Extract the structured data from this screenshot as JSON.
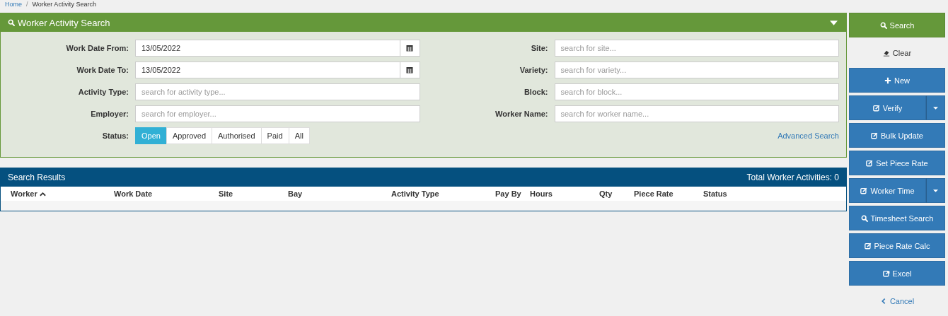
{
  "breadcrumb_separator": "/",
  "breadcrumb": [
    {
      "label": "Home",
      "kind": "link"
    },
    {
      "label": "Worker Activity Search",
      "kind": "current"
    }
  ],
  "search_panel": {
    "title": "Worker Activity Search",
    "expanded": true,
    "left_fields": [
      {
        "label": "Work Date From:",
        "value": "13/05/2022",
        "kind": "date"
      },
      {
        "label": "Work Date To:",
        "value": "13/05/2022",
        "kind": "date"
      },
      {
        "label": "Activity Type:",
        "placeholder": "search for activity type...",
        "kind": "text"
      },
      {
        "label": "Employer:",
        "placeholder": "search for employer...",
        "kind": "text"
      }
    ],
    "right_fields": [
      {
        "label": "Site:",
        "placeholder": "search for site...",
        "kind": "text"
      },
      {
        "label": "Variety:",
        "placeholder": "search for variety...",
        "kind": "text"
      },
      {
        "label": "Block:",
        "placeholder": "search for block...",
        "kind": "text"
      },
      {
        "label": "Worker Name:",
        "placeholder": "search for worker name...",
        "kind": "text"
      }
    ],
    "status_label": "Status:",
    "status_options": [
      {
        "label": "Open",
        "selected": true
      },
      {
        "label": "Approved",
        "selected": false
      },
      {
        "label": "Authorised",
        "selected": false
      },
      {
        "label": "Paid",
        "selected": false
      },
      {
        "label": "All",
        "selected": false
      }
    ],
    "advanced_link": "Advanced Search"
  },
  "results": {
    "title": "Search Results",
    "total": "Total Worker Activities: 0",
    "columns": [
      {
        "label": "Worker",
        "sorted": true
      },
      {
        "label": "Work Date",
        "sorted": false
      },
      {
        "label": "Site",
        "sorted": false
      },
      {
        "label": "Bay",
        "sorted": false
      },
      {
        "label": "Activity Type",
        "sorted": false
      },
      {
        "label": "Pay By",
        "sorted": false
      },
      {
        "label": "Hours",
        "sorted": false
      },
      {
        "label": "Qty",
        "sorted": false
      },
      {
        "label": "Piece Rate",
        "sorted": false
      },
      {
        "label": "Status",
        "sorted": false
      }
    ]
  },
  "actions": [
    {
      "label": "Search",
      "kind": "success",
      "dropdown": false
    },
    {
      "label": "Clear",
      "kind": "plain",
      "dropdown": false
    },
    {
      "label": "New",
      "kind": "primary",
      "dropdown": false
    },
    {
      "label": "Verify",
      "kind": "primary",
      "dropdown": true
    },
    {
      "label": "Bulk Update",
      "kind": "primary",
      "dropdown": false
    },
    {
      "label": "Set Piece Rate",
      "kind": "primary",
      "dropdown": false
    },
    {
      "label": "Worker Time",
      "kind": "primary",
      "dropdown": true
    },
    {
      "label": "Timesheet Search",
      "kind": "primary",
      "dropdown": false
    },
    {
      "label": "Piece Rate Calc",
      "kind": "primary",
      "dropdown": false
    },
    {
      "label": "Excel",
      "kind": "primary",
      "dropdown": false
    },
    {
      "label": "Cancel",
      "kind": "link",
      "dropdown": false
    }
  ]
}
